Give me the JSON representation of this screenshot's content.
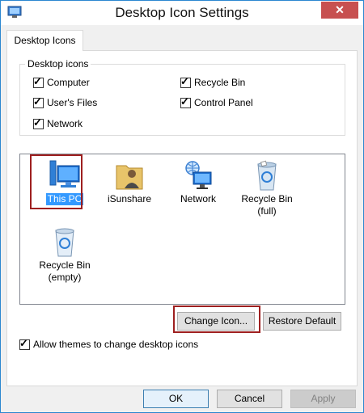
{
  "window": {
    "title": "Desktop Icon Settings",
    "close_glyph": "✕"
  },
  "tab": {
    "label": "Desktop Icons"
  },
  "group": {
    "label": "Desktop icons",
    "checkboxes": [
      {
        "label": "Computer",
        "checked": true
      },
      {
        "label": "User's Files",
        "checked": true
      },
      {
        "label": "Network",
        "checked": true
      },
      {
        "label": "Recycle Bin",
        "checked": true
      },
      {
        "label": "Control Panel",
        "checked": true
      }
    ]
  },
  "icons": [
    {
      "label": "This PC",
      "icon": "computer-icon",
      "selected": true
    },
    {
      "label": "iSunshare",
      "icon": "user-folder-icon"
    },
    {
      "label": "Network",
      "icon": "network-icon"
    },
    {
      "label": "Recycle Bin (full)",
      "line1": "Recycle Bin",
      "line2": "(full)",
      "icon": "recycle-bin-full-icon"
    },
    {
      "label": "Recycle Bin (empty)",
      "line1": "Recycle Bin",
      "line2": "(empty)",
      "icon": "recycle-bin-empty-icon"
    }
  ],
  "buttons": {
    "change_icon": "Change Icon...",
    "restore_default": "Restore Default",
    "ok": "OK",
    "cancel": "Cancel",
    "apply": "Apply"
  },
  "themes_checkbox": {
    "label": "Allow themes to change desktop icons",
    "checked": true
  },
  "colors": {
    "selection": "#3399ff",
    "highlight_frame": "#9e1f1f",
    "close": "#c75050"
  }
}
